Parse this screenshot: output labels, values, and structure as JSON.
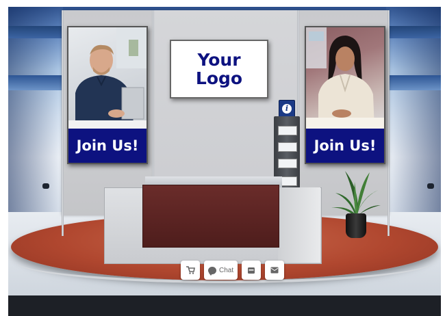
{
  "booth": {
    "logo_text": "Your Logo",
    "logo_line1": "Your",
    "logo_line2": "Logo",
    "poster_left_caption": "Join Us!",
    "poster_right_caption": "Join Us!",
    "info_icon": "info-icon"
  },
  "toolbar": {
    "cart_icon": "cart-icon",
    "chat_label": "Chat",
    "chat_icon": "chat-icon",
    "calendar_icon": "calendar-icon",
    "mail_icon": "mail-icon"
  },
  "colors": {
    "accent": "#0d1280",
    "stage": "#b0472f",
    "counter_panel": "#5a2423"
  }
}
